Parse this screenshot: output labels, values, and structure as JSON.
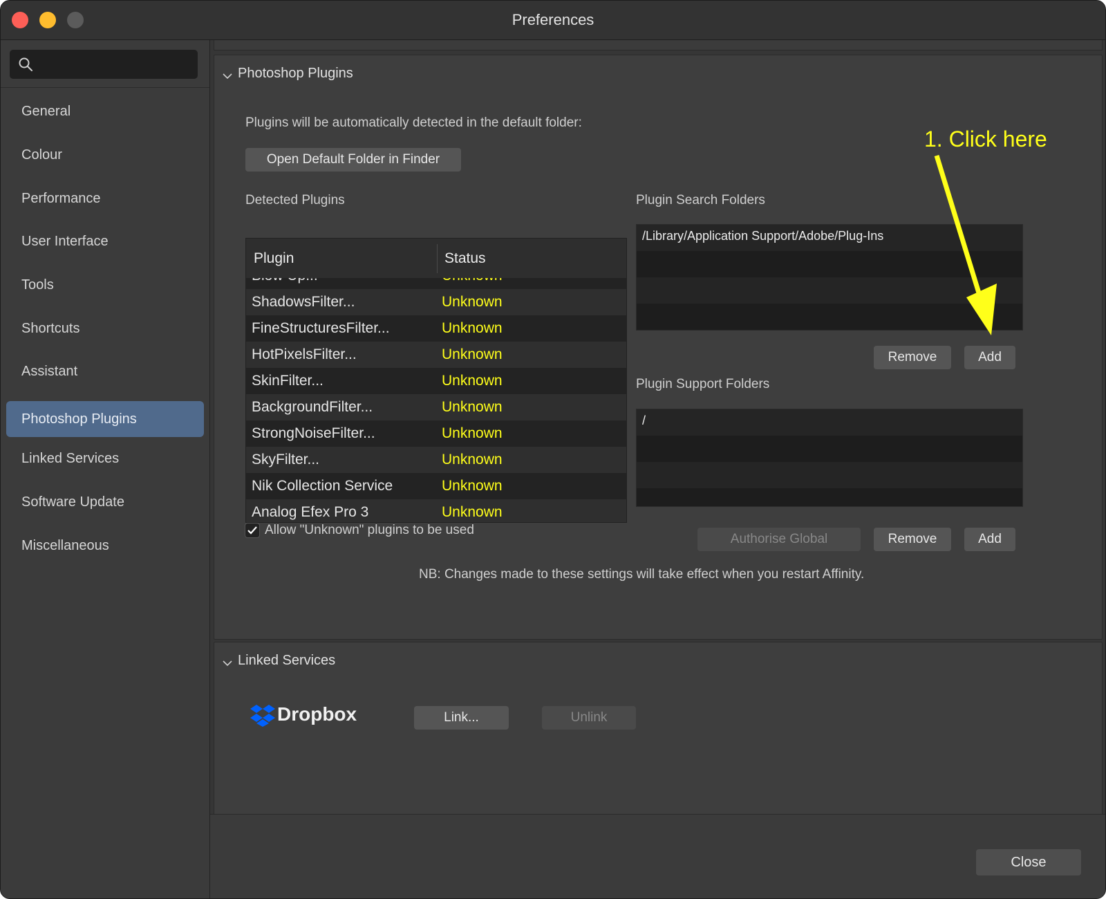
{
  "window": {
    "title": "Preferences"
  },
  "sidebar": {
    "search": {
      "placeholder": "",
      "value": ""
    },
    "items": [
      {
        "label": "General"
      },
      {
        "label": "Colour"
      },
      {
        "label": "Performance"
      },
      {
        "label": "User Interface"
      },
      {
        "label": "Tools"
      },
      {
        "label": "Shortcuts"
      },
      {
        "label": "Assistant"
      },
      {
        "label": "Photoshop Plugins",
        "selected": true
      },
      {
        "label": "Linked Services"
      },
      {
        "label": "Software Update"
      },
      {
        "label": "Miscellaneous"
      }
    ]
  },
  "photoshop_plugins": {
    "header": "Photoshop Plugins",
    "default_folder_text": "Plugins will be automatically detected in the default folder:",
    "open_folder_button": "Open Default Folder in Finder",
    "detected_label": "Detected Plugins",
    "table": {
      "columns": [
        "Plugin",
        "Status"
      ],
      "rows": [
        {
          "plugin": "Blow Up...",
          "status": "Unknown"
        },
        {
          "plugin": "ShadowsFilter...",
          "status": "Unknown"
        },
        {
          "plugin": "FineStructuresFilter...",
          "status": "Unknown"
        },
        {
          "plugin": "HotPixelsFilter...",
          "status": "Unknown"
        },
        {
          "plugin": "SkinFilter...",
          "status": "Unknown"
        },
        {
          "plugin": "BackgroundFilter...",
          "status": "Unknown"
        },
        {
          "plugin": "StrongNoiseFilter...",
          "status": "Unknown"
        },
        {
          "plugin": "SkyFilter...",
          "status": "Unknown"
        },
        {
          "plugin": "Nik Collection Service",
          "status": "Unknown"
        },
        {
          "plugin": "Analog Efex Pro 3",
          "status": "Unknown"
        }
      ]
    },
    "search_folders": {
      "label": "Plugin Search Folders",
      "items": [
        "/Library/Application Support/Adobe/Plug-Ins"
      ],
      "remove_button": "Remove",
      "add_button": "Add"
    },
    "support_folders": {
      "label": "Plugin Support Folders",
      "items": [
        "/"
      ],
      "authorise_button": "Authorise Global",
      "remove_button": "Remove",
      "add_button": "Add"
    },
    "allow_unknown": {
      "label": "Allow \"Unknown\" plugins to be used",
      "checked": true
    },
    "note": "NB: Changes made to these settings will take effect when you restart Affinity."
  },
  "annotation": {
    "text": "1. Click here",
    "color": "#ffff1a"
  },
  "linked_services": {
    "header": "Linked Services",
    "service_name": "Dropbox",
    "link_button": "Link...",
    "unlink_button": "Unlink"
  },
  "footer": {
    "close_button": "Close"
  },
  "colors": {
    "accent": "#506a8c",
    "status_unknown": "#ffff1a",
    "dropbox": "#0061fe"
  }
}
